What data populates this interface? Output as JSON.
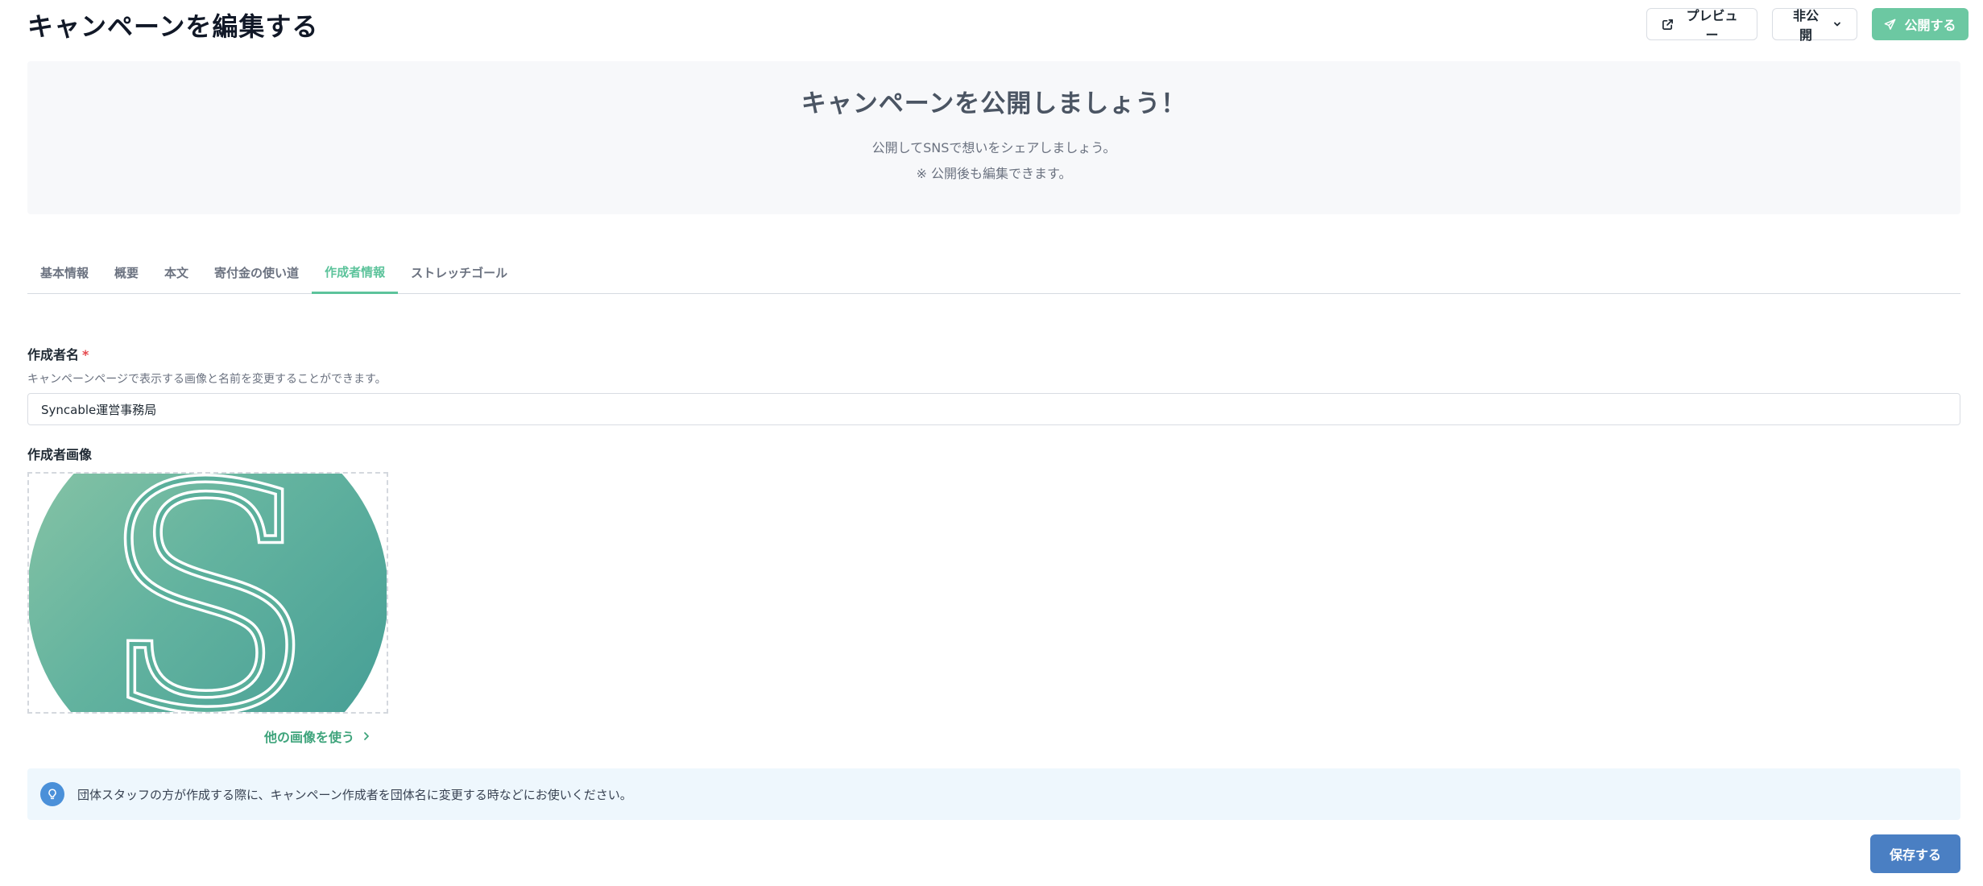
{
  "header": {
    "title": "キャンペーンを編集する",
    "preview_label": "プレビュー",
    "visibility_label": "非公開",
    "publish_label": "公開する"
  },
  "banner": {
    "title": "キャンペーンを公開しましょう！",
    "line1": "公開してSNSで想いをシェアしましょう。",
    "line2": "※ 公開後も編集できます。"
  },
  "tabs": [
    {
      "label": "基本情報",
      "active": false
    },
    {
      "label": "概要",
      "active": false
    },
    {
      "label": "本文",
      "active": false
    },
    {
      "label": "寄付金の使い道",
      "active": false
    },
    {
      "label": "作成者情報",
      "active": true
    },
    {
      "label": "ストレッチゴール",
      "active": false
    }
  ],
  "form": {
    "author_name_label": "作成者名",
    "required_mark": "*",
    "author_name_help": "キャンペーンページで表示する画像と名前を変更することができます。",
    "author_name_value": "Syncable運営事務局",
    "author_image_label": "作成者画像",
    "image_logo_letter": "S",
    "other_image_label": "他の画像を使う"
  },
  "info": {
    "text": "団体スタッフの方が作成する際に、キャンペーン作成者を団体名に変更する時などにお使いください。"
  },
  "actions": {
    "save_label": "保存する"
  },
  "colors": {
    "accent_green": "#5cc39b",
    "publish_button": "#6cc8a2",
    "save_button": "#4a7fc3",
    "info_background": "#eef7fd",
    "info_icon": "#4a90d9",
    "banner_background": "#f7f8fa"
  },
  "icons": {
    "preview": "external-link-icon",
    "visibility": "chevron-down-icon",
    "publish": "paper-plane-icon",
    "other_image": "chevron-right-icon",
    "info": "lightbulb-icon"
  }
}
